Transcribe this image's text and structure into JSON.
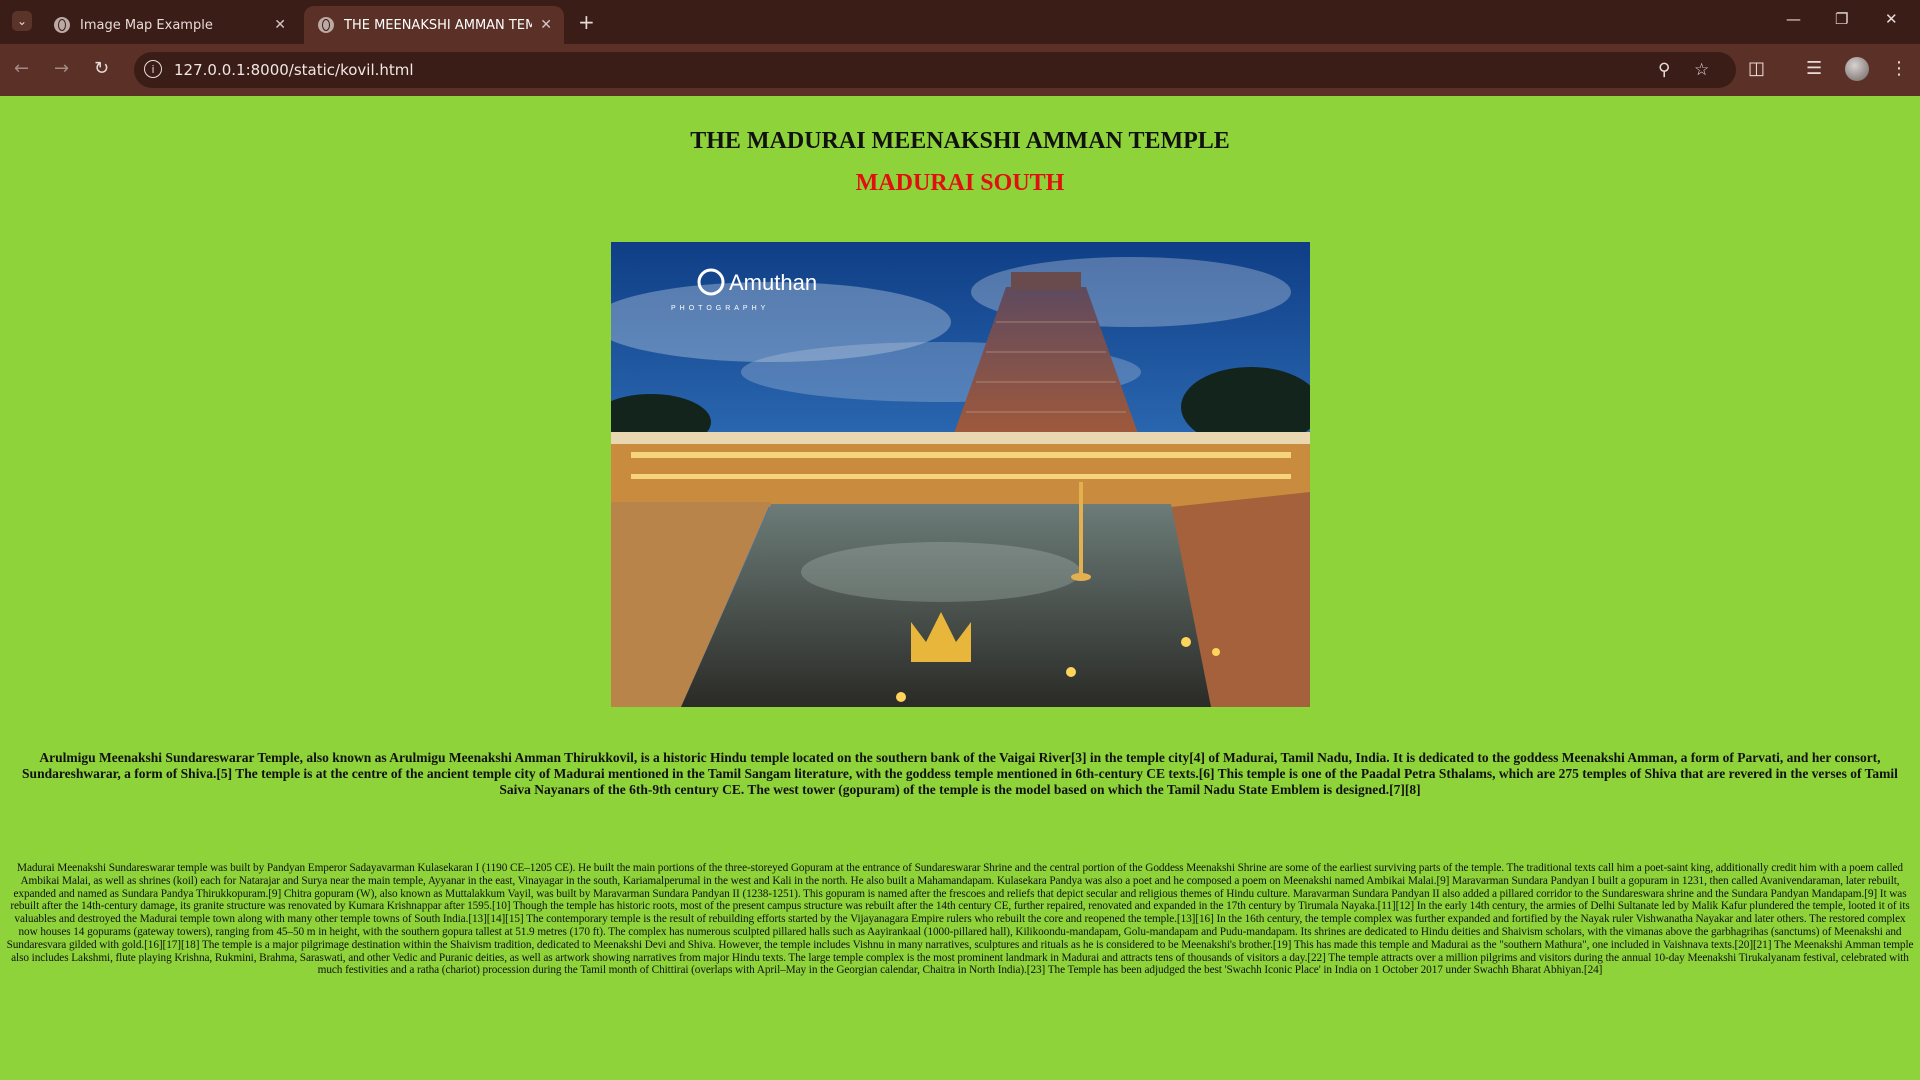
{
  "browser": {
    "tabs": [
      {
        "title": "Image Map Example",
        "active": false
      },
      {
        "title": "THE MEENAKSHI AMMAN TEM",
        "active": true
      }
    ],
    "url": "127.0.0.1:8000/static/kovil.html"
  },
  "page": {
    "title": "THE MADURAI MEENAKSHI AMMAN TEMPLE",
    "subtitle": "MADURAI SOUTH",
    "image_watermark": "Amuthan PHOTOGRAPHY",
    "paragraph1": "Arulmigu Meenakshi Sundareswarar Temple, also known as Arulmigu Meenakshi Amman Thirukkovil, is a historic Hindu temple located on the southern bank of the Vaigai River[3] in the temple city[4] of Madurai, Tamil Nadu, India. It is dedicated to the goddess Meenakshi Amman, a form of Parvati, and her consort, Sundareshwarar, a form of Shiva.[5] The temple is at the centre of the ancient temple city of Madurai mentioned in the Tamil Sangam literature, with the goddess temple mentioned in 6th-century CE texts.[6] This temple is one of the Paadal Petra Sthalams, which are 275 temples of Shiva that are revered in the verses of Tamil Saiva Nayanars of the 6th-9th century CE. The west tower (gopuram) of the temple is the model based on which the Tamil Nadu State Emblem is designed.[7][8]",
    "paragraph2": "Madurai Meenakshi Sundareswarar temple was built by Pandyan Emperor Sadayavarman Kulasekaran I (1190 CE–1205 CE). He built the main portions of the three-storeyed Gopuram at the entrance of Sundareswarar Shrine and the central portion of the Goddess Meenakshi Shrine are some of the earliest surviving parts of the temple. The traditional texts call him a poet-saint king, additionally credit him with a poem called Ambikai Malai, as well as shrines (koil) each for Natarajar and Surya near the main temple, Ayyanar in the east, Vinayagar in the south, Kariamalperumal in the west and Kali in the north. He also built a Mahamandapam. Kulasekara Pandya was also a poet and he composed a poem on Meenakshi named Ambikai Malai.[9] Maravarman Sundara Pandyan I built a gopuram in 1231, then called Avanivendaraman, later rebuilt, expanded and named as Sundara Pandya Thirukkopuram.[9] Chitra gopuram (W), also known as Muttalakkum Vayil, was built by Maravarman Sundara Pandyan II (1238-1251). This gopuram is named after the frescoes and reliefs that depict secular and religious themes of Hindu culture. Maravarman Sundara Pandyan II also added a pillared corridor to the Sundareswara shrine and the Sundara Pandyan Mandapam.[9] It was rebuilt after the 14th-century damage, its granite structure was renovated by Kumara Krishnappar after 1595.[10] Though the temple has historic roots, most of the present campus structure was rebuilt after the 14th century CE, further repaired, renovated and expanded in the 17th century by Tirumala Nayaka.[11][12] In the early 14th century, the armies of Delhi Sultanate led by Malik Kafur plundered the temple, looted it of its valuables and destroyed the Madurai temple town along with many other temple towns of South India.[13][14][15] The contemporary temple is the result of rebuilding efforts started by the Vijayanagara Empire rulers who rebuilt the core and reopened the temple.[13][16] In the 16th century, the temple complex was further expanded and fortified by the Nayak ruler Vishwanatha Nayakar and later others. The restored complex now houses 14 gopurams (gateway towers), ranging from 45–50 m in height, with the southern gopura tallest at 51.9 metres (170 ft). The complex has numerous sculpted pillared halls such as Aayirankaal (1000-pillared hall), Kilikoondu-mandapam, Golu-mandapam and Pudu-mandapam. Its shrines are dedicated to Hindu deities and Shaivism scholars, with the vimanas above the garbhagrihas (sanctums) of Meenakshi and Sundaresvara gilded with gold.[16][17][18] The temple is a major pilgrimage destination within the Shaivism tradition, dedicated to Meenakshi Devi and Shiva. However, the temple includes Vishnu in many narratives, sculptures and rituals as he is considered to be Meenakshi's brother.[19] This has made this temple and Madurai as the \"southern Mathura\", one included in Vaishnava texts.[20][21] The Meenakshi Amman temple also includes Lakshmi, flute playing Krishna, Rukmini, Brahma, Saraswati, and other Vedic and Puranic deities, as well as artwork showing narratives from major Hindu texts. The large temple complex is the most prominent landmark in Madurai and attracts tens of thousands of visitors a day.[22] The temple attracts over a million pilgrims and visitors during the annual 10-day Meenakshi Tirukalyanam festival, celebrated with much festivities and a ratha (chariot) procession during the Tamil month of Chittirai (overlaps with April–May in the Georgian calendar, Chaitra in North India).[23] The Temple has been adjudged the best 'Swachh Iconic Place' in India on 1 October 2017 under Swachh Bharat Abhiyan.[24]"
  },
  "colors": {
    "page_background": "#8fd33a",
    "subtitle": "#e10f0f",
    "chrome_dark": "#3a1d16",
    "chrome_toolbar": "#5b3026"
  },
  "icons": [
    "tab-search-icon",
    "globe-favicon-icon",
    "close-icon",
    "new-tab-icon",
    "minimize-icon",
    "maximize-icon",
    "window-close-icon",
    "back-icon",
    "forward-icon",
    "reload-icon",
    "site-info-icon",
    "zoom-icon",
    "bookmark-star-icon",
    "extensions-icon",
    "media-control-icon",
    "profile-avatar",
    "kebab-menu-icon"
  ]
}
